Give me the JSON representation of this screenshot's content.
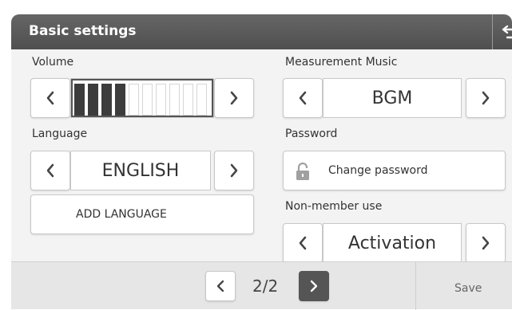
{
  "window": {
    "title": "Basic settings"
  },
  "volume": {
    "label": "Volume",
    "level": 4,
    "max": 10
  },
  "measurement_music": {
    "label": "Measurement Music",
    "value": "BGM"
  },
  "language": {
    "label": "Language",
    "value": "ENGLISH",
    "add_label": "ADD LANGUAGE"
  },
  "password": {
    "label": "Password",
    "change_label": "Change password"
  },
  "non_member": {
    "label": "Non-member use",
    "value": "Activation"
  },
  "footer": {
    "page": "2/2",
    "save_label": "Save"
  },
  "colors": {
    "titlebar": "#5a5a5a",
    "panel": "#f3f3f3",
    "footer": "#e6e6e6",
    "next_page_button": "#555555"
  },
  "icons": [
    "back-arrow-icon",
    "chevron-left-icon",
    "chevron-right-icon",
    "lock-icon"
  ]
}
